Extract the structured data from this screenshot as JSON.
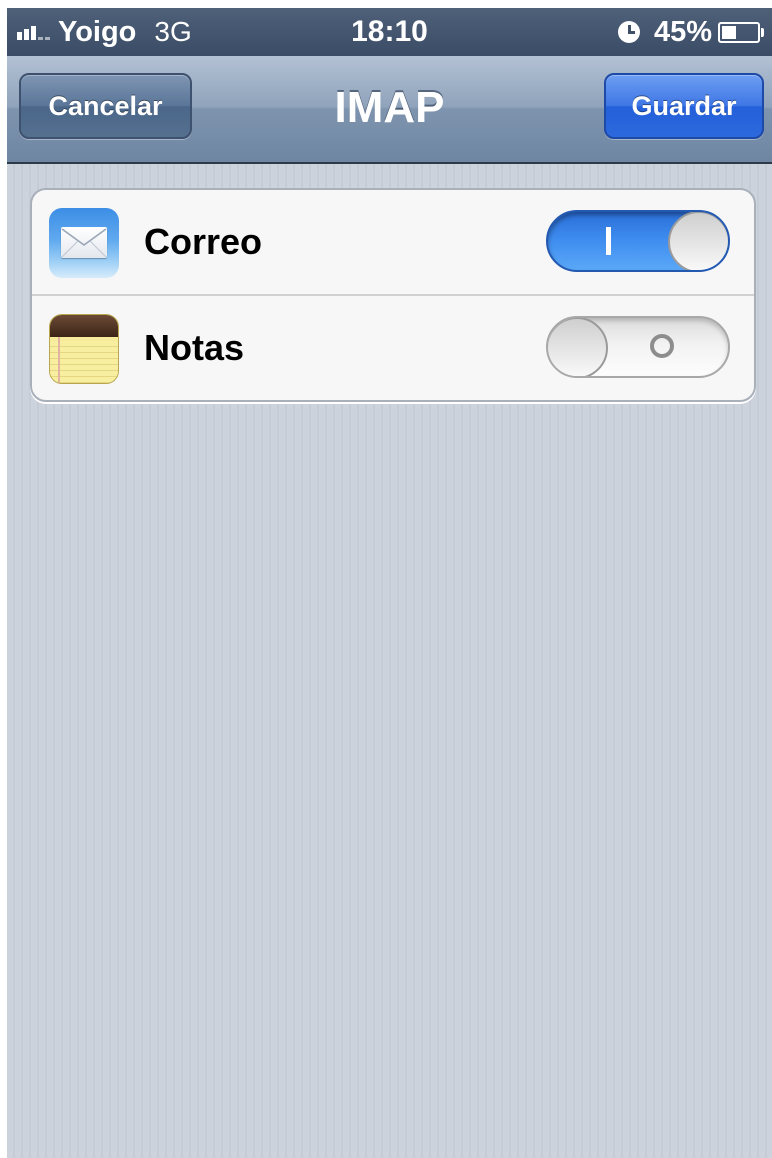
{
  "status_bar": {
    "carrier": "Yoigo",
    "network": "3G",
    "time": "18:10",
    "battery_percent": "45%",
    "battery_level": 0.45,
    "signal_icon": "signal-bars-icon",
    "clock_icon": "alarm-clock-icon",
    "battery_icon": "battery-icon"
  },
  "nav": {
    "title": "IMAP",
    "cancel_label": "Cancelar",
    "save_label": "Guardar"
  },
  "settings": {
    "items": [
      {
        "label": "Correo",
        "icon": "mail-app-icon",
        "enabled": true
      },
      {
        "label": "Notas",
        "icon": "notes-app-icon",
        "enabled": false
      }
    ]
  },
  "colors": {
    "toggle_on": "#3f8ef0",
    "save_button": "#2d69dd",
    "nav_bar": "#8fa3bb",
    "background": "#cdd3dc"
  }
}
